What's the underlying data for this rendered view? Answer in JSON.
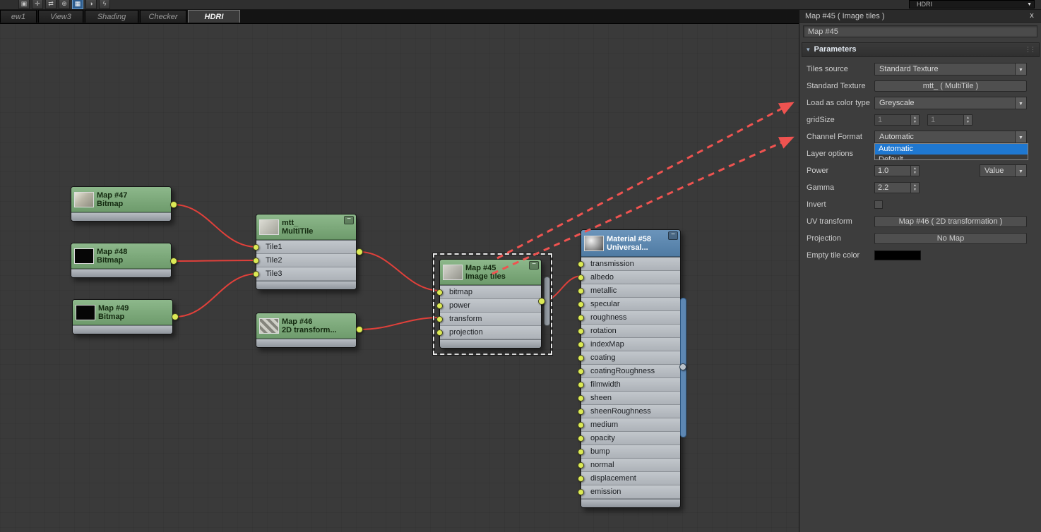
{
  "toolbar": {
    "icons": [
      {
        "name": "save-icon",
        "glyph": "▣",
        "active": false
      },
      {
        "name": "pan-icon",
        "glyph": "✛",
        "active": false
      },
      {
        "name": "swap-wires-icon",
        "glyph": "⇄",
        "active": false
      },
      {
        "name": "zoom-icon",
        "glyph": "⊕",
        "active": false
      },
      {
        "name": "layout-grid-icon",
        "glyph": "▦",
        "active": true
      },
      {
        "name": "palette-icon",
        "glyph": "◑",
        "active": false
      },
      {
        "name": "pick-material-icon",
        "glyph": "ϟ",
        "active": false
      }
    ]
  },
  "top_right_combo": {
    "value": "HDRI",
    "arrow": "▼"
  },
  "tabs": [
    {
      "label": "ew1",
      "active": false
    },
    {
      "label": "View3",
      "active": false
    },
    {
      "label": "Shading",
      "active": false
    },
    {
      "label": "Checker",
      "active": false
    },
    {
      "label": "HDRI",
      "active": true
    }
  ],
  "nodes": {
    "map47": {
      "title": "Map #47",
      "subtitle": "Bitmap"
    },
    "map48": {
      "title": "Map #48",
      "subtitle": "Bitmap"
    },
    "map49": {
      "title": "Map #49",
      "subtitle": "Bitmap"
    },
    "multitile": {
      "title": "mtt_",
      "subtitle": "MultiTile",
      "minimize": "−",
      "slots": [
        "Tile1",
        "Tile2",
        "Tile3"
      ]
    },
    "map46": {
      "title": "Map #46",
      "subtitle": "2D transform..."
    },
    "map45": {
      "title": "Map #45",
      "subtitle": "Image tiles",
      "minimize": "−",
      "slots": [
        "bitmap",
        "power",
        "transform",
        "projection"
      ]
    },
    "material58": {
      "title": "Material #58",
      "subtitle": "Universal...",
      "minimize": "−",
      "slots": [
        "transmission",
        "albedo",
        "metallic",
        "specular",
        "roughness",
        "rotation",
        "indexMap",
        "coating",
        "coatingRoughness",
        "filmwidth",
        "sheen",
        "sheenRoughness",
        "medium",
        "opacity",
        "bump",
        "normal",
        "displacement",
        "emission"
      ]
    }
  },
  "connections": [
    {
      "from": "Map #47",
      "to": "mtt_.Tile1"
    },
    {
      "from": "Map #48",
      "to": "mtt_.Tile2"
    },
    {
      "from": "Map #49",
      "to": "mtt_.Tile3"
    },
    {
      "from": "mtt_",
      "to": "Map #45.bitmap"
    },
    {
      "from": "Map #46",
      "to": "Map #45.transform"
    },
    {
      "from": "Map #45",
      "to": "Material #58.albedo"
    }
  ],
  "panel": {
    "title": "Map #45  ( Image tiles )",
    "close_label": "x",
    "name_value": "Map #45",
    "rollout_title": "Parameters",
    "rollout_arrow": "▾",
    "rollout_grip": "⋮⋮",
    "params": {
      "tiles_source": {
        "label": "Tiles source",
        "value": "Standard Texture"
      },
      "standard_texture": {
        "label": "Standard Texture",
        "value": "mtt_  ( MultiTile )"
      },
      "load_color_type": {
        "label": "Load as color type",
        "value": "Greyscale"
      },
      "grid_size": {
        "label": "gridSize",
        "value1": "1",
        "value2": "1"
      },
      "channel_format": {
        "label": "Channel Format",
        "value": "Automatic",
        "items": [
          "Automatic",
          "Default"
        ]
      },
      "layer_options": {
        "label": "Layer options"
      },
      "power": {
        "label": "Power",
        "value": "1.0",
        "mode": "Value"
      },
      "gamma": {
        "label": "Gamma",
        "value": "2.2"
      },
      "invert": {
        "label": "Invert"
      },
      "uv_transform": {
        "label": "UV transform",
        "value": "Map #46  ( 2D transformation )"
      },
      "projection": {
        "label": "Projection",
        "value": "No Map"
      },
      "empty_tile_color": {
        "label": "Empty tile color",
        "color": "#000000"
      }
    }
  },
  "colors": {
    "node_green": "#74a274",
    "material_blue": "#5b87b2",
    "wire_red": "#e0403a",
    "socket_yellow": "#dcea55",
    "selection_highlight": "#1f78d1",
    "annotation_red": "#ef5350"
  }
}
